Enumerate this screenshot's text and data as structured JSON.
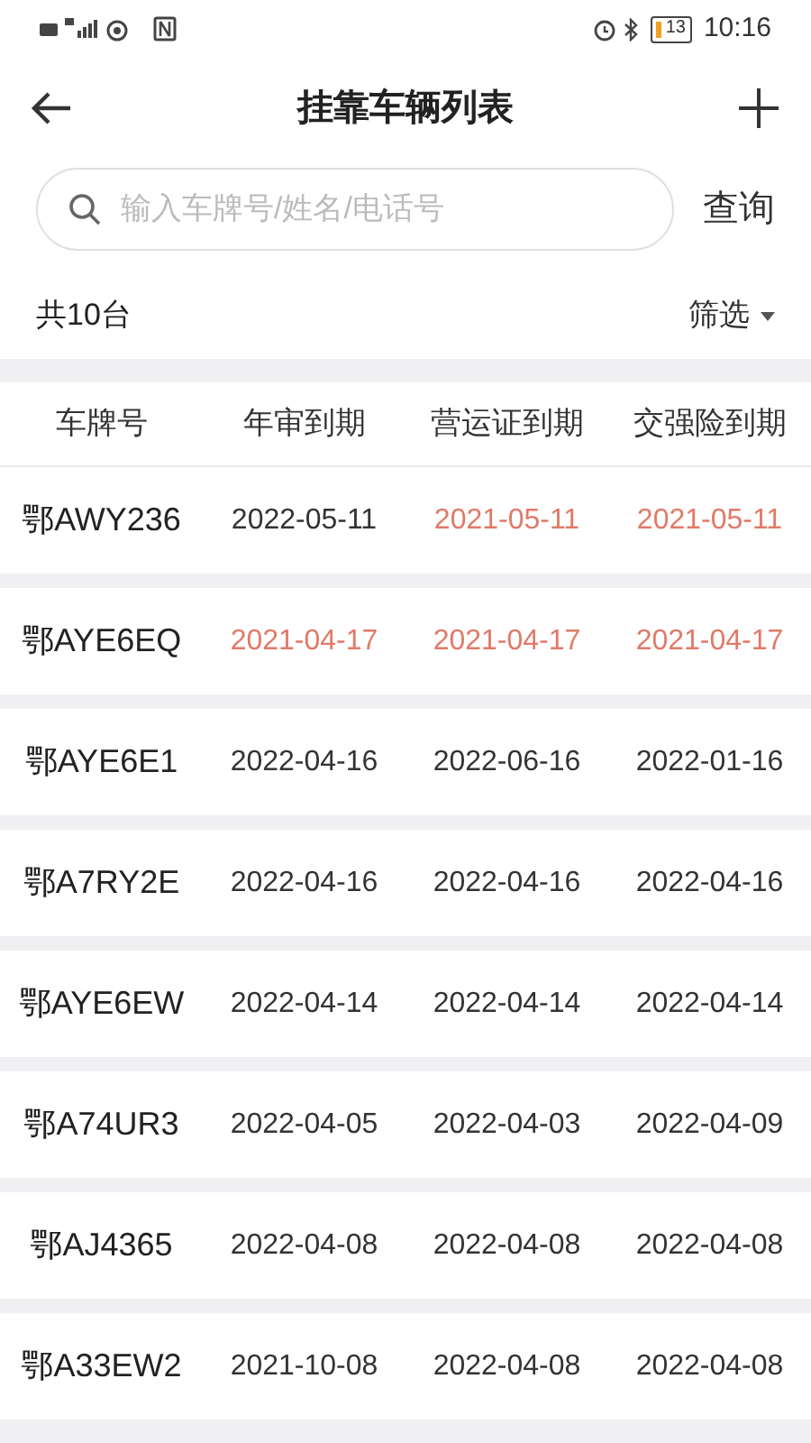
{
  "status_bar": {
    "battery": "13",
    "time": "10:16"
  },
  "header": {
    "title": "挂靠车辆列表"
  },
  "search": {
    "placeholder": "输入车牌号/姓名/电话号",
    "button": "查询"
  },
  "summary": {
    "count": "共10台",
    "filter": "筛选"
  },
  "table": {
    "columns": [
      "车牌号",
      "年审到期",
      "营运证到期",
      "交强险到期"
    ],
    "rows": [
      {
        "plate": "鄂AWY236",
        "dates": [
          {
            "text": "2022-05-11",
            "expired": false
          },
          {
            "text": "2021-05-11",
            "expired": true
          },
          {
            "text": "2021-05-11",
            "expired": true
          }
        ]
      },
      {
        "plate": "鄂AYE6EQ",
        "dates": [
          {
            "text": "2021-04-17",
            "expired": true
          },
          {
            "text": "2021-04-17",
            "expired": true
          },
          {
            "text": "2021-04-17",
            "expired": true
          }
        ]
      },
      {
        "plate": "鄂AYE6E1",
        "dates": [
          {
            "text": "2022-04-16",
            "expired": false
          },
          {
            "text": "2022-06-16",
            "expired": false
          },
          {
            "text": "2022-01-16",
            "expired": false
          }
        ]
      },
      {
        "plate": "鄂A7RY2E",
        "dates": [
          {
            "text": "2022-04-16",
            "expired": false
          },
          {
            "text": "2022-04-16",
            "expired": false
          },
          {
            "text": "2022-04-16",
            "expired": false
          }
        ]
      },
      {
        "plate": "鄂AYE6EW",
        "dates": [
          {
            "text": "2022-04-14",
            "expired": false
          },
          {
            "text": "2022-04-14",
            "expired": false
          },
          {
            "text": "2022-04-14",
            "expired": false
          }
        ]
      },
      {
        "plate": "鄂A74UR3",
        "dates": [
          {
            "text": "2022-04-05",
            "expired": false
          },
          {
            "text": "2022-04-03",
            "expired": false
          },
          {
            "text": "2022-04-09",
            "expired": false
          }
        ]
      },
      {
        "plate": "鄂AJ4365",
        "dates": [
          {
            "text": "2022-04-08",
            "expired": false
          },
          {
            "text": "2022-04-08",
            "expired": false
          },
          {
            "text": "2022-04-08",
            "expired": false
          }
        ]
      },
      {
        "plate": "鄂A33EW2",
        "dates": [
          {
            "text": "2021-10-08",
            "expired": false
          },
          {
            "text": "2022-04-08",
            "expired": false
          },
          {
            "text": "2022-04-08",
            "expired": false
          }
        ]
      }
    ]
  }
}
